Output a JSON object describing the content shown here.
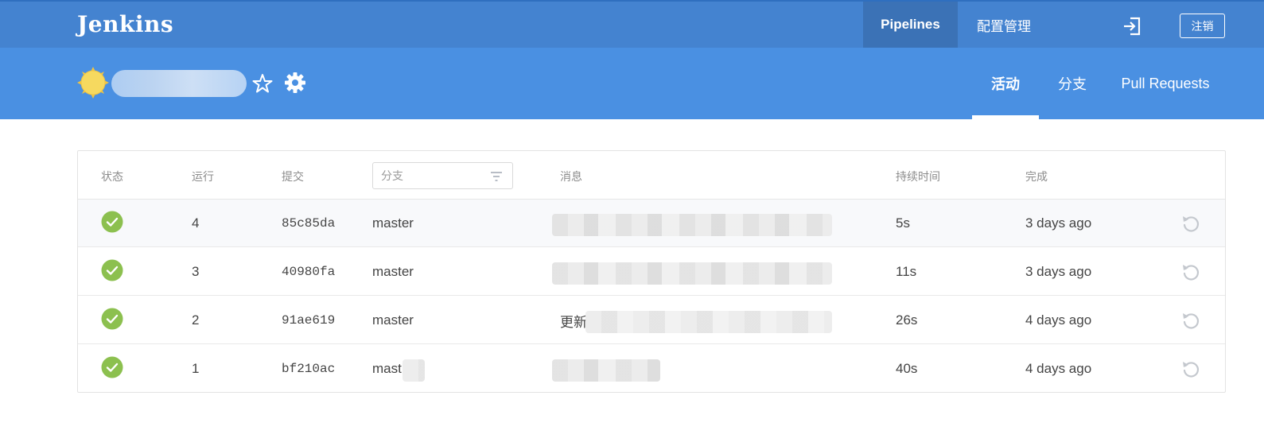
{
  "app": {
    "title": "Jenkins"
  },
  "topnav": {
    "pipelines": "Pipelines",
    "config": "配置管理",
    "logout": "注销"
  },
  "pipeline": {
    "name": ""
  },
  "tabs": {
    "activity": "活动",
    "branches": "分支",
    "pull_requests": "Pull Requests"
  },
  "table": {
    "headers": {
      "status": "状态",
      "run": "运行",
      "commit": "提交",
      "branch_placeholder": "分支",
      "message": "消息",
      "duration": "持续时间",
      "completed": "完成"
    },
    "rows": [
      {
        "status": "success",
        "run": "4",
        "commit": "85c85da",
        "branch": "master",
        "message": "",
        "duration": "5s",
        "completed": "3 days ago"
      },
      {
        "status": "success",
        "run": "3",
        "commit": "40980fa",
        "branch": "master",
        "message": "",
        "duration": "11s",
        "completed": "3 days ago"
      },
      {
        "status": "success",
        "run": "2",
        "commit": "91ae619",
        "branch": "master",
        "message": "更新",
        "duration": "26s",
        "completed": "4 days ago"
      },
      {
        "status": "success",
        "run": "1",
        "commit": "bf210ac",
        "branch": "mast",
        "message": "",
        "duration": "40s",
        "completed": "4 days ago"
      }
    ]
  },
  "colors": {
    "topbar": "#4483d0",
    "subbar": "#4a90e2",
    "success": "#8cc04f",
    "weather_sunny": "#f6d95f"
  }
}
